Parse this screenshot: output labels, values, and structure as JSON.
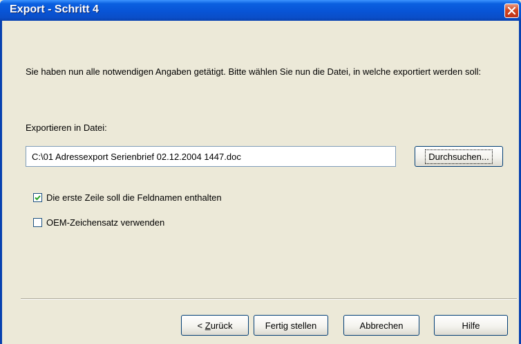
{
  "window": {
    "title": "Export - Schritt 4"
  },
  "main": {
    "intro_text": "Sie haben nun alle notwendigen Angaben getätigt. Bitte wählen Sie nun die Datei, in welche exportiert werden soll:",
    "file_label": "Exportieren in Datei:",
    "file_path": "C:\\01 Adressexport Serienbrief 02.12.2004 1447.doc",
    "browse_label": "Durchsuchen...",
    "checkboxes": [
      {
        "label": "Die erste Zeile soll die Feldnamen enthalten",
        "checked": true
      },
      {
        "label": "OEM-Zeichensatz verwenden",
        "checked": false
      }
    ]
  },
  "footer": {
    "back_prefix": "< ",
    "back_mnemonic": "Z",
    "back_rest": "urück",
    "finish_label": "Fertig stellen",
    "cancel_label": "Abbrechen",
    "help_label": "Hilfe"
  },
  "colors": {
    "face": "#ECE9D8",
    "titlebar": "#0854D6",
    "close": "#D2461F"
  },
  "icons": [
    "close-icon",
    "checkmark-icon"
  ]
}
